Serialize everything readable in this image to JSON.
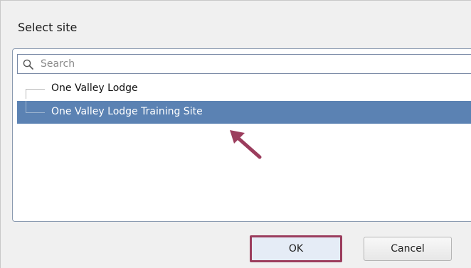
{
  "dialog": {
    "title": "Select site"
  },
  "search": {
    "placeholder": "Search",
    "value": ""
  },
  "sites": [
    {
      "label": "One Valley Lodge",
      "selected": false
    },
    {
      "label": "One Valley Lodge Training Site",
      "selected": true
    }
  ],
  "buttons": {
    "ok_label": "OK",
    "cancel_label": "Cancel"
  },
  "colors": {
    "selection": "#5b82b3",
    "annotation": "#9b3d5d",
    "dialog_background": "#f0f0f0"
  },
  "icons": {
    "search": "search-icon",
    "pointer": "arrow-pointer-icon"
  }
}
